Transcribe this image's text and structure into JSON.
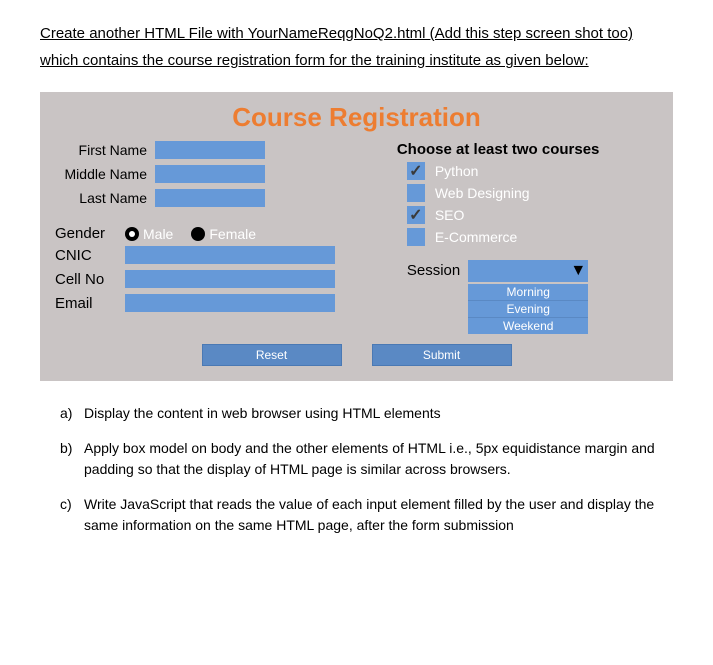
{
  "intro": "Create another HTML File with YourNameReqgNoQ2.html (Add this step screen shot too) which contains  the course registration form for the training institute as given below:",
  "form": {
    "title": "Course Registration",
    "labels": {
      "first_name": "First Name",
      "middle_name": "Middle Name",
      "last_name": "Last Name",
      "gender": "Gender",
      "male": "Male",
      "female": "Female",
      "cnic": "CNIC",
      "cell_no": "Cell No",
      "email": "Email",
      "courses_title": "Choose at least two courses",
      "session": "Session"
    },
    "courses": [
      {
        "label": "Python",
        "checked": true
      },
      {
        "label": "Web Designing",
        "checked": false
      },
      {
        "label": "SEO",
        "checked": true
      },
      {
        "label": "E-Commerce",
        "checked": false
      }
    ],
    "session_options": [
      "Morning",
      "Evening",
      "Weekend"
    ],
    "buttons": {
      "reset": "Reset",
      "submit": "Submit"
    }
  },
  "questions": [
    {
      "letter": "a)",
      "text": "Display the content in web browser using HTML elements"
    },
    {
      "letter": "b)",
      "text": "Apply box model on body and the other elements of HTML i.e., 5px equidistance margin and padding so that the display of HTML page is similar across browsers."
    },
    {
      "letter": "c)",
      "text": "Write JavaScript that reads the value of each input element filled by the user and display the same information on the same HTML page, after the form submission"
    }
  ]
}
